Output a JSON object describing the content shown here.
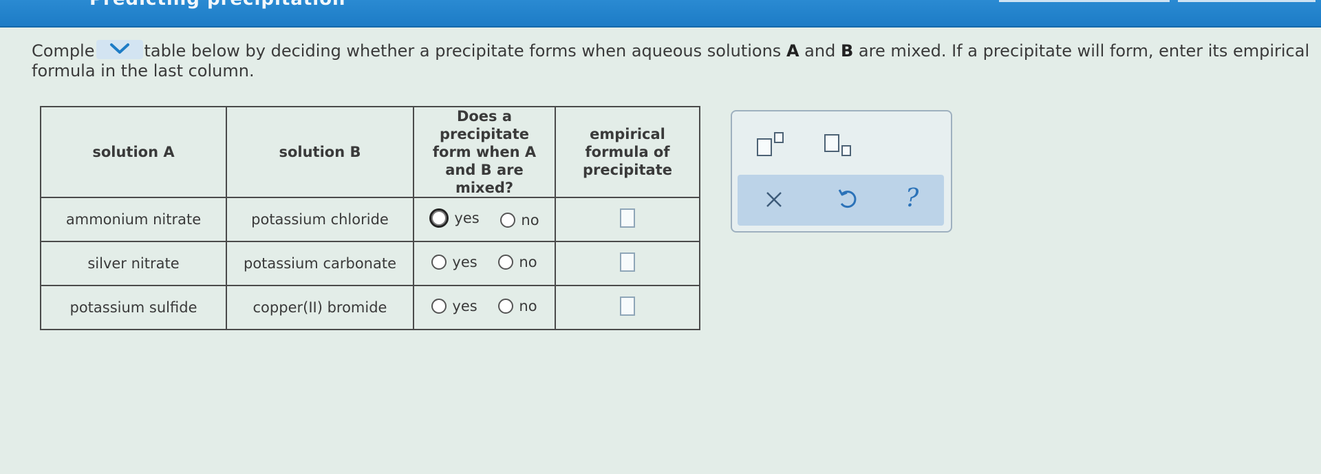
{
  "header": {
    "title": "Predicting precipitation"
  },
  "instructions": {
    "part1": "Comple",
    "part2": "table below by deciding whether a precipitate forms when aqueous solutions",
    "bold_a": "A",
    "and": "and",
    "bold_b": "B",
    "part3": "are mixed. If a precipitate will form, enter its empirical formula in the last column."
  },
  "table": {
    "headers": {
      "solution_a": "solution A",
      "solution_b": "solution B",
      "does_precipitate": "Does a precipitate form when A and B are mixed?",
      "empirical_formula": "empirical formula of precipitate"
    },
    "rows": [
      {
        "solution_a": "ammonium nitrate",
        "solution_b": "potassium chloride",
        "yes_label": "yes",
        "no_label": "no"
      },
      {
        "solution_a": "silver nitrate",
        "solution_b": "potassium carbonate",
        "yes_label": "yes",
        "no_label": "no"
      },
      {
        "solution_a": "potassium sulfide",
        "solution_b": "copper(II) bromide",
        "yes_label": "yes",
        "no_label": "no"
      }
    ]
  },
  "tools": {
    "superscript_icon": "superscript-icon",
    "subscript_icon": "subscript-icon",
    "clear_icon": "close-icon",
    "undo_icon": "undo-icon",
    "help_label": "?"
  },
  "colors": {
    "header_blue": "#1d7cc6",
    "accent_blue": "#2b72b8",
    "action_bar": "#bcd3e8"
  }
}
